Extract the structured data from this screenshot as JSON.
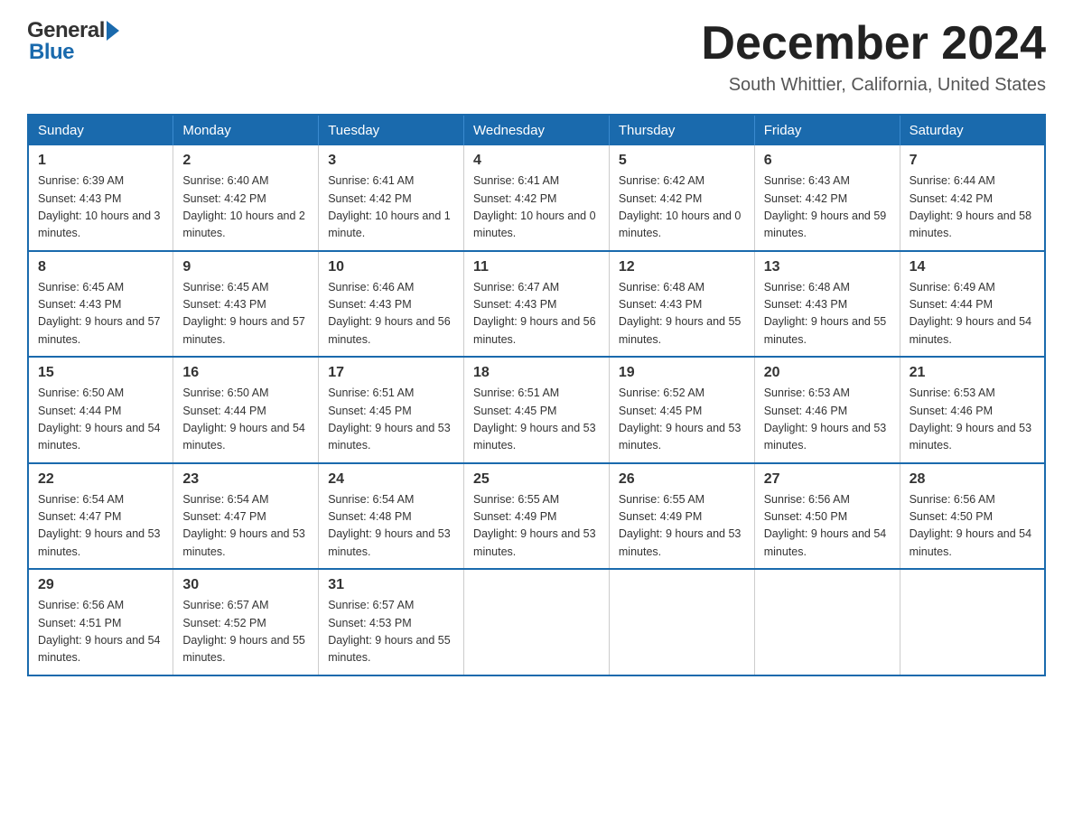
{
  "header": {
    "logo_text_gen": "General",
    "logo_text_blue": "Blue",
    "title": "December 2024",
    "subtitle": "South Whittier, California, United States"
  },
  "weekdays": [
    "Sunday",
    "Monday",
    "Tuesday",
    "Wednesday",
    "Thursday",
    "Friday",
    "Saturday"
  ],
  "weeks": [
    [
      {
        "day": "1",
        "sunrise": "6:39 AM",
        "sunset": "4:43 PM",
        "daylight": "10 hours and 3 minutes."
      },
      {
        "day": "2",
        "sunrise": "6:40 AM",
        "sunset": "4:42 PM",
        "daylight": "10 hours and 2 minutes."
      },
      {
        "day": "3",
        "sunrise": "6:41 AM",
        "sunset": "4:42 PM",
        "daylight": "10 hours and 1 minute."
      },
      {
        "day": "4",
        "sunrise": "6:41 AM",
        "sunset": "4:42 PM",
        "daylight": "10 hours and 0 minutes."
      },
      {
        "day": "5",
        "sunrise": "6:42 AM",
        "sunset": "4:42 PM",
        "daylight": "10 hours and 0 minutes."
      },
      {
        "day": "6",
        "sunrise": "6:43 AM",
        "sunset": "4:42 PM",
        "daylight": "9 hours and 59 minutes."
      },
      {
        "day": "7",
        "sunrise": "6:44 AM",
        "sunset": "4:42 PM",
        "daylight": "9 hours and 58 minutes."
      }
    ],
    [
      {
        "day": "8",
        "sunrise": "6:45 AM",
        "sunset": "4:43 PM",
        "daylight": "9 hours and 57 minutes."
      },
      {
        "day": "9",
        "sunrise": "6:45 AM",
        "sunset": "4:43 PM",
        "daylight": "9 hours and 57 minutes."
      },
      {
        "day": "10",
        "sunrise": "6:46 AM",
        "sunset": "4:43 PM",
        "daylight": "9 hours and 56 minutes."
      },
      {
        "day": "11",
        "sunrise": "6:47 AM",
        "sunset": "4:43 PM",
        "daylight": "9 hours and 56 minutes."
      },
      {
        "day": "12",
        "sunrise": "6:48 AM",
        "sunset": "4:43 PM",
        "daylight": "9 hours and 55 minutes."
      },
      {
        "day": "13",
        "sunrise": "6:48 AM",
        "sunset": "4:43 PM",
        "daylight": "9 hours and 55 minutes."
      },
      {
        "day": "14",
        "sunrise": "6:49 AM",
        "sunset": "4:44 PM",
        "daylight": "9 hours and 54 minutes."
      }
    ],
    [
      {
        "day": "15",
        "sunrise": "6:50 AM",
        "sunset": "4:44 PM",
        "daylight": "9 hours and 54 minutes."
      },
      {
        "day": "16",
        "sunrise": "6:50 AM",
        "sunset": "4:44 PM",
        "daylight": "9 hours and 54 minutes."
      },
      {
        "day": "17",
        "sunrise": "6:51 AM",
        "sunset": "4:45 PM",
        "daylight": "9 hours and 53 minutes."
      },
      {
        "day": "18",
        "sunrise": "6:51 AM",
        "sunset": "4:45 PM",
        "daylight": "9 hours and 53 minutes."
      },
      {
        "day": "19",
        "sunrise": "6:52 AM",
        "sunset": "4:45 PM",
        "daylight": "9 hours and 53 minutes."
      },
      {
        "day": "20",
        "sunrise": "6:53 AM",
        "sunset": "4:46 PM",
        "daylight": "9 hours and 53 minutes."
      },
      {
        "day": "21",
        "sunrise": "6:53 AM",
        "sunset": "4:46 PM",
        "daylight": "9 hours and 53 minutes."
      }
    ],
    [
      {
        "day": "22",
        "sunrise": "6:54 AM",
        "sunset": "4:47 PM",
        "daylight": "9 hours and 53 minutes."
      },
      {
        "day": "23",
        "sunrise": "6:54 AM",
        "sunset": "4:47 PM",
        "daylight": "9 hours and 53 minutes."
      },
      {
        "day": "24",
        "sunrise": "6:54 AM",
        "sunset": "4:48 PM",
        "daylight": "9 hours and 53 minutes."
      },
      {
        "day": "25",
        "sunrise": "6:55 AM",
        "sunset": "4:49 PM",
        "daylight": "9 hours and 53 minutes."
      },
      {
        "day": "26",
        "sunrise": "6:55 AM",
        "sunset": "4:49 PM",
        "daylight": "9 hours and 53 minutes."
      },
      {
        "day": "27",
        "sunrise": "6:56 AM",
        "sunset": "4:50 PM",
        "daylight": "9 hours and 54 minutes."
      },
      {
        "day": "28",
        "sunrise": "6:56 AM",
        "sunset": "4:50 PM",
        "daylight": "9 hours and 54 minutes."
      }
    ],
    [
      {
        "day": "29",
        "sunrise": "6:56 AM",
        "sunset": "4:51 PM",
        "daylight": "9 hours and 54 minutes."
      },
      {
        "day": "30",
        "sunrise": "6:57 AM",
        "sunset": "4:52 PM",
        "daylight": "9 hours and 55 minutes."
      },
      {
        "day": "31",
        "sunrise": "6:57 AM",
        "sunset": "4:53 PM",
        "daylight": "9 hours and 55 minutes."
      },
      null,
      null,
      null,
      null
    ]
  ],
  "labels": {
    "sunrise_prefix": "Sunrise: ",
    "sunset_prefix": "Sunset: ",
    "daylight_prefix": "Daylight: "
  }
}
